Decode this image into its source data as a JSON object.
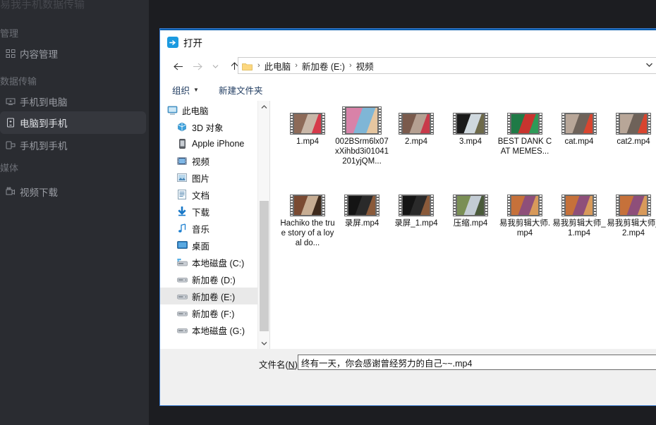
{
  "app": {
    "title": "易我手机数据传输",
    "sections": [
      {
        "label": "管理"
      },
      {
        "label": "数据传输"
      },
      {
        "label": "媒体"
      }
    ],
    "nav": [
      {
        "label": "内容管理",
        "icon": "grid-icon",
        "selected": false
      },
      {
        "label": "手机到电脑",
        "icon": "phone-to-pc-icon",
        "selected": false
      },
      {
        "label": "电脑到手机",
        "icon": "pc-to-phone-icon",
        "selected": true
      },
      {
        "label": "手机到手机",
        "icon": "phone-to-phone-icon",
        "selected": false
      },
      {
        "label": "视频下载",
        "icon": "video-download-icon",
        "selected": false
      }
    ],
    "accent": "#35373d"
  },
  "dialog": {
    "title": "打开",
    "title_icon": "open-folder-icon",
    "accent": "#0b5dab",
    "nav": {
      "back": "←",
      "forward": "→",
      "recent": "⌄",
      "up": "↑"
    },
    "address": {
      "folder_icon": "folder-icon",
      "crumbs": [
        "此电脑",
        "新加卷 (E:)",
        "视频"
      ],
      "separator": "›",
      "dropdown_icon": "chevron-down-icon"
    },
    "commandbar": {
      "organize": "组织",
      "organize_caret": "▼",
      "new_folder": "新建文件夹"
    },
    "tree": {
      "items": [
        {
          "label": "此电脑",
          "icon": "computer-icon",
          "indent": 0,
          "selected": false
        },
        {
          "label": "3D 对象",
          "icon": "3d-objects-icon",
          "indent": 1,
          "selected": false
        },
        {
          "label": "Apple iPhone",
          "icon": "iphone-icon",
          "indent": 1,
          "selected": false
        },
        {
          "label": "视频",
          "icon": "videos-icon",
          "indent": 1,
          "selected": false
        },
        {
          "label": "图片",
          "icon": "pictures-icon",
          "indent": 1,
          "selected": false
        },
        {
          "label": "文档",
          "icon": "documents-icon",
          "indent": 1,
          "selected": false
        },
        {
          "label": "下载",
          "icon": "downloads-icon",
          "indent": 1,
          "selected": false
        },
        {
          "label": "音乐",
          "icon": "music-icon",
          "indent": 1,
          "selected": false
        },
        {
          "label": "桌面",
          "icon": "desktop-icon",
          "indent": 1,
          "selected": false
        },
        {
          "label": "本地磁盘 (C:)",
          "icon": "system-drive-icon",
          "indent": 1,
          "selected": false
        },
        {
          "label": "新加卷 (D:)",
          "icon": "drive-icon",
          "indent": 1,
          "selected": false
        },
        {
          "label": "新加卷 (E:)",
          "icon": "drive-icon",
          "indent": 1,
          "selected": true
        },
        {
          "label": "新加卷 (F:)",
          "icon": "drive-icon",
          "indent": 1,
          "selected": false
        },
        {
          "label": "本地磁盘 (G:)",
          "icon": "drive-icon",
          "indent": 1,
          "selected": false
        }
      ],
      "scroll_up_icon": "chevron-up-icon",
      "scroll_down_icon": "chevron-down-icon"
    },
    "files": [
      {
        "name": "1.mp4",
        "c1": "#8d6a58",
        "c2": "#c9b7a8",
        "c3": "#d63a4a"
      },
      {
        "name": "002BSrm6lx07xXihbd3i01041201yjQM...",
        "c1": "#d882a8",
        "c2": "#7fb6d6",
        "c3": "#e6c6a0"
      },
      {
        "name": "2.mp4",
        "c1": "#7a5a4c",
        "c2": "#b5a092",
        "c3": "#c83a4a"
      },
      {
        "name": "3.mp4",
        "c1": "#1a1a1a",
        "c2": "#cfd8de",
        "c3": "#6e6a4a"
      },
      {
        "name": "BEST DANK CAT MEMES...",
        "c1": "#1f7a46",
        "c2": "#c8342f",
        "c3": "#2e9a58"
      },
      {
        "name": "cat.mp4",
        "c1": "#b8a698",
        "c2": "#6e6259",
        "c3": "#d8452f"
      },
      {
        "name": "cat2.mp4",
        "c1": "#b8a698",
        "c2": "#6e6259",
        "c3": "#d8452f"
      },
      {
        "name": "Hachiko the true story of a loyal do...",
        "c1": "#7a4a32",
        "c2": "#c7ad93",
        "c3": "#3e2a1c"
      },
      {
        "name": "录屏.mp4",
        "c1": "#141414",
        "c2": "#2a2a2a",
        "c3": "#8a5a3a"
      },
      {
        "name": "录屏_1.mp4",
        "c1": "#141414",
        "c2": "#2a2a2a",
        "c3": "#8a5a3a"
      },
      {
        "name": "压缩.mp4",
        "c1": "#7a8f55",
        "c2": "#c3ccd4",
        "c3": "#4a5a3a"
      },
      {
        "name": "易我剪辑大师.mp4",
        "c1": "#c6713a",
        "c2": "#8e4f7a",
        "c3": "#d89a5a"
      },
      {
        "name": "易我剪辑大师_1.mp4",
        "c1": "#c6713a",
        "c2": "#8e4f7a",
        "c3": "#d89a5a"
      },
      {
        "name": "易我剪辑大师_2.mp4",
        "c1": "#c6713a",
        "c2": "#8e4f7a",
        "c3": "#d89a5a"
      }
    ],
    "filename": {
      "label_prefix": "文件名(",
      "label_accel": "N",
      "label_suffix": "):",
      "value": "终有一天，你会感谢曾经努力的自己~~.mp4",
      "placeholder": ""
    }
  }
}
